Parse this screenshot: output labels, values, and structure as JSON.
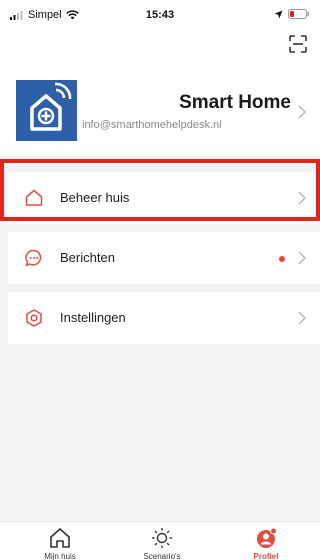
{
  "status_bar": {
    "carrier": "Simpel",
    "time": "15:43"
  },
  "header": {
    "scan_icon": "scan-icon"
  },
  "profile": {
    "name": "Smart Home",
    "email": "info@smarthomehelpdesk.nl",
    "avatar_color": "#2d60a8"
  },
  "menu": [
    {
      "label": "Beheer huis",
      "icon": "house-icon",
      "highlighted": true
    },
    {
      "label": "Berichten",
      "icon": "message-icon",
      "has_unread_dot": true
    },
    {
      "label": "Instellingen",
      "icon": "settings-icon"
    }
  ],
  "tabs": [
    {
      "label": "Mijn huis",
      "icon": "home-icon",
      "active": false
    },
    {
      "label": "Scenario's",
      "icon": "sun-icon",
      "active": false
    },
    {
      "label": "Profiel",
      "icon": "profile-icon",
      "active": true
    }
  ],
  "colors": {
    "accent": "#e24b41",
    "highlight_border": "#e0261b"
  }
}
